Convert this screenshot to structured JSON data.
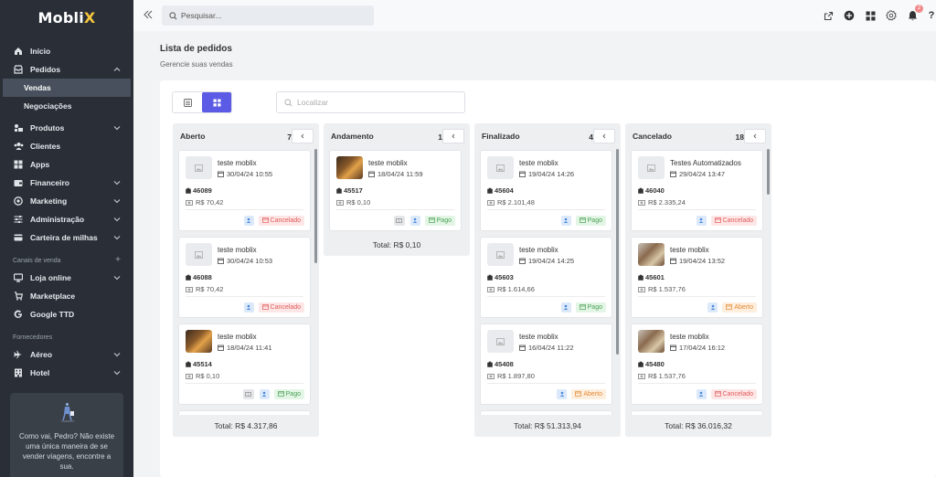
{
  "app": {
    "logo_main": "Mobli",
    "logo_x": "X"
  },
  "sidebar": {
    "items": [
      {
        "label": "Início",
        "icon": "home-icon"
      },
      {
        "label": "Pedidos",
        "icon": "inbox-icon",
        "expanded": true
      },
      {
        "label": "Produtos",
        "icon": "products-icon"
      },
      {
        "label": "Clientes",
        "icon": "users-icon"
      },
      {
        "label": "Apps",
        "icon": "apps-icon"
      },
      {
        "label": "Financeiro",
        "icon": "wallet-icon"
      },
      {
        "label": "Marketing",
        "icon": "target-icon"
      },
      {
        "label": "Administração",
        "icon": "sliders-icon"
      },
      {
        "label": "Carteira de milhas",
        "icon": "card-icon"
      },
      {
        "label": "Loja online",
        "icon": "monitor-icon"
      },
      {
        "label": "Marketplace",
        "icon": "shopping-bag-icon"
      },
      {
        "label": "Google TTD",
        "icon": "google-icon"
      },
      {
        "label": "Aéreo",
        "icon": "plane-icon"
      },
      {
        "label": "Hotel",
        "icon": "hotel-icon"
      }
    ],
    "sub_vendas": "Vendas",
    "sub_negociacoes": "Negociações",
    "section_canais": "Canais de venda",
    "section_fornecedores": "Fornecedores",
    "promo_text": "Como vai, Pedro? Não existe uma única maneira de se vender viagens, encontre a sua."
  },
  "topbar": {
    "search_placeholder": "Pesquisar...",
    "notifications_count": "2",
    "colors": {
      "accent": "#5b5be6"
    }
  },
  "page": {
    "title": "Lista de pedidos",
    "subtitle": "Gerencie suas vendas",
    "locate_placeholder": "Localizar"
  },
  "columns": [
    {
      "title": "Aberto",
      "count": "7",
      "total": "Total: R$ 4.317,86",
      "cards": [
        {
          "title": "teste moblix",
          "date": "30/04/24 10:55",
          "id": "46089",
          "price": "R$ 70,42",
          "status": "Cancelado",
          "status_type": "cancel"
        },
        {
          "title": "teste moblix",
          "date": "30/04/24 10:53",
          "id": "46088",
          "price": "R$ 70,42",
          "status": "Cancelado",
          "status_type": "cancel"
        },
        {
          "title": "teste moblix",
          "date": "18/04/24 11:41",
          "id": "45514",
          "price": "R$ 0,10",
          "status": "Pago",
          "status_type": "paid"
        }
      ]
    },
    {
      "title": "Andamento",
      "count": "1",
      "total": "Total: R$ 0,10",
      "cards": [
        {
          "title": "teste moblix",
          "date": "18/04/24 11:59",
          "id": "45517",
          "price": "R$ 0,10",
          "status": "Pago",
          "status_type": "paid"
        }
      ]
    },
    {
      "title": "Finalizado",
      "count": "4",
      "total": "Total: R$ 51.313,94",
      "cards": [
        {
          "title": "teste moblix",
          "date": "19/04/24 14:26",
          "id": "45604",
          "price": "R$ 2.101,48",
          "status": "Pago",
          "status_type": "paid"
        },
        {
          "title": "teste moblix",
          "date": "19/04/24 14:25",
          "id": "45603",
          "price": "R$ 1.614,66",
          "status": "Pago",
          "status_type": "paid"
        },
        {
          "title": "teste moblix",
          "date": "16/04/24 11:22",
          "id": "45408",
          "price": "R$ 1.897,80",
          "status": "Aberto",
          "status_type": "open"
        }
      ]
    },
    {
      "title": "Cancelado",
      "count": "18",
      "total": "Total: R$ 36.016,32",
      "cards": [
        {
          "title": "Testes Automatizados",
          "date": "29/04/24 13:47",
          "id": "46040",
          "price": "R$ 2.335,24",
          "status": "Cancelado",
          "status_type": "cancel"
        },
        {
          "title": "teste moblix",
          "date": "19/04/24 13:52",
          "id": "45601",
          "price": "R$ 1.537,76",
          "status": "Aberto",
          "status_type": "open"
        },
        {
          "title": "teste moblix",
          "date": "17/04/24 16:12",
          "id": "45480",
          "price": "R$ 1.537,76",
          "status": "Cancelado",
          "status_type": "cancel"
        }
      ]
    }
  ]
}
